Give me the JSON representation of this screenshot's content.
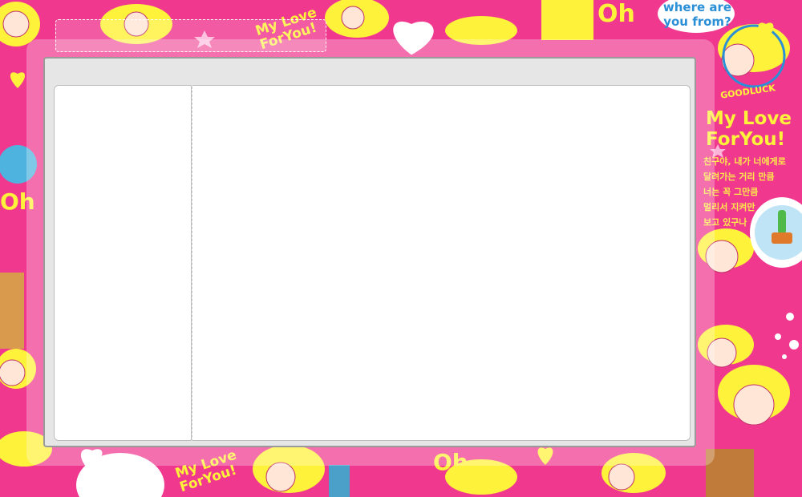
{
  "decor": {
    "bubble_text_line1": "where are",
    "bubble_text_line2": "you from?",
    "oh_top": "Oh",
    "oh_left": "Oh",
    "oh_bottom": "Oh",
    "love_top_line1": "My Love",
    "love_top_line2": "ForYou!",
    "love_right_line1": "My Love",
    "love_right_line2": "ForYou!",
    "love_bottom_line1": "My Love",
    "love_bottom_line2": "ForYou!",
    "goodluck": "GOODLUCK",
    "korean_lines": [
      "친구야, 내가 너에게로",
      "달려가는 거리 만큼",
      "너는 꼭 그만큼",
      "멀리서 지켜만",
      "보고 있구나"
    ]
  },
  "colors": {
    "background": "#f0388f",
    "accent_yellow": "#fff23a",
    "frame_gray": "#e6e6e6",
    "page_white": "#ffffff"
  }
}
